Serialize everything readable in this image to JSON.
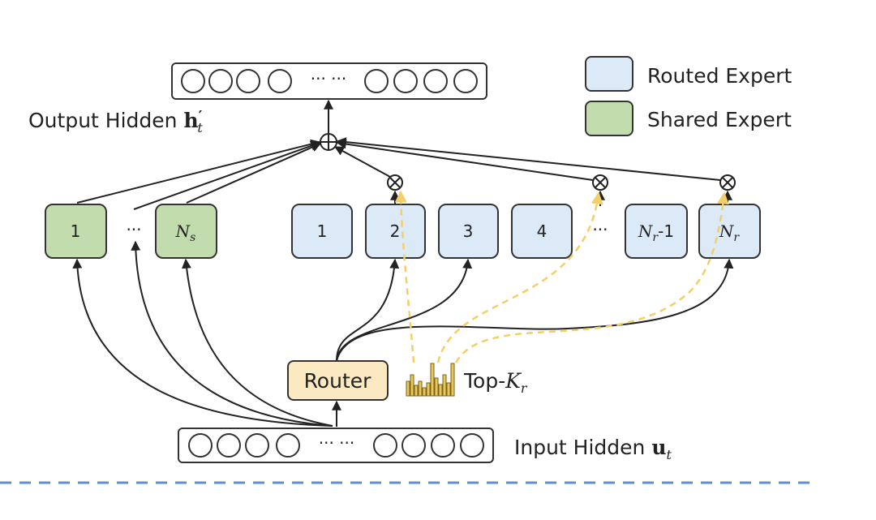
{
  "legend": {
    "routed_label": "Routed Expert",
    "shared_label": "Shared Expert"
  },
  "colors": {
    "routed_fill": "#dce9f6",
    "shared_fill": "#c3dcae",
    "router_fill": "#fbe9c2",
    "topk_bars": "#e8c65a",
    "dashed_path": "#f2cf6a",
    "separator": "#5b8fd0",
    "stroke": "#333333"
  },
  "output": {
    "label": "Output Hidden ",
    "symbol": "h",
    "prime": "′",
    "sub": "t",
    "ellipsis": "··· ···"
  },
  "input": {
    "label": "Input Hidden ",
    "symbol": "u",
    "sub": "t",
    "ellipsis": "··· ···"
  },
  "shared_experts": {
    "first": "1",
    "ellipsis": "···",
    "last_symbol": "N",
    "last_sub": "s"
  },
  "routed_experts": {
    "items": [
      "1",
      "2",
      "3",
      "4"
    ],
    "ellipsis": "···",
    "second_last_symbol": "N",
    "second_last_sub": "r",
    "second_last_suffix": "-1",
    "last_symbol": "N",
    "last_sub": "r"
  },
  "router": {
    "label": "Router"
  },
  "topk": {
    "label": "Top-",
    "symbol": "K",
    "sub": "r"
  }
}
